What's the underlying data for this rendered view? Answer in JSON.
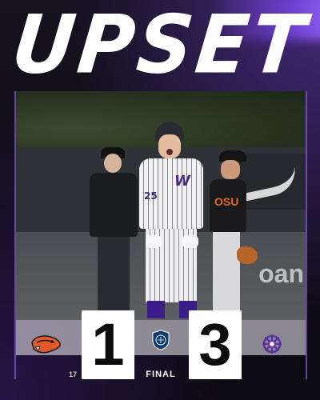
{
  "headline": "UPSET",
  "scoreboard": {
    "away_score": "1",
    "home_score": "3",
    "status": "FINAL",
    "detail": "17"
  },
  "teams": {
    "away": {
      "logo_icon": "beaver-logo-icon",
      "color": "#e2592a"
    },
    "home": {
      "logo_icon": "husky-helm-logo-icon",
      "color": "#5b2ea8"
    }
  },
  "photo": {
    "jersey_number": "25",
    "opponent_jersey_text": "OSU",
    "signage_text": "oan"
  },
  "colors": {
    "accent_purple": "#6a3bd0",
    "background": "#0d0b14",
    "score_box": "#ffffff"
  }
}
